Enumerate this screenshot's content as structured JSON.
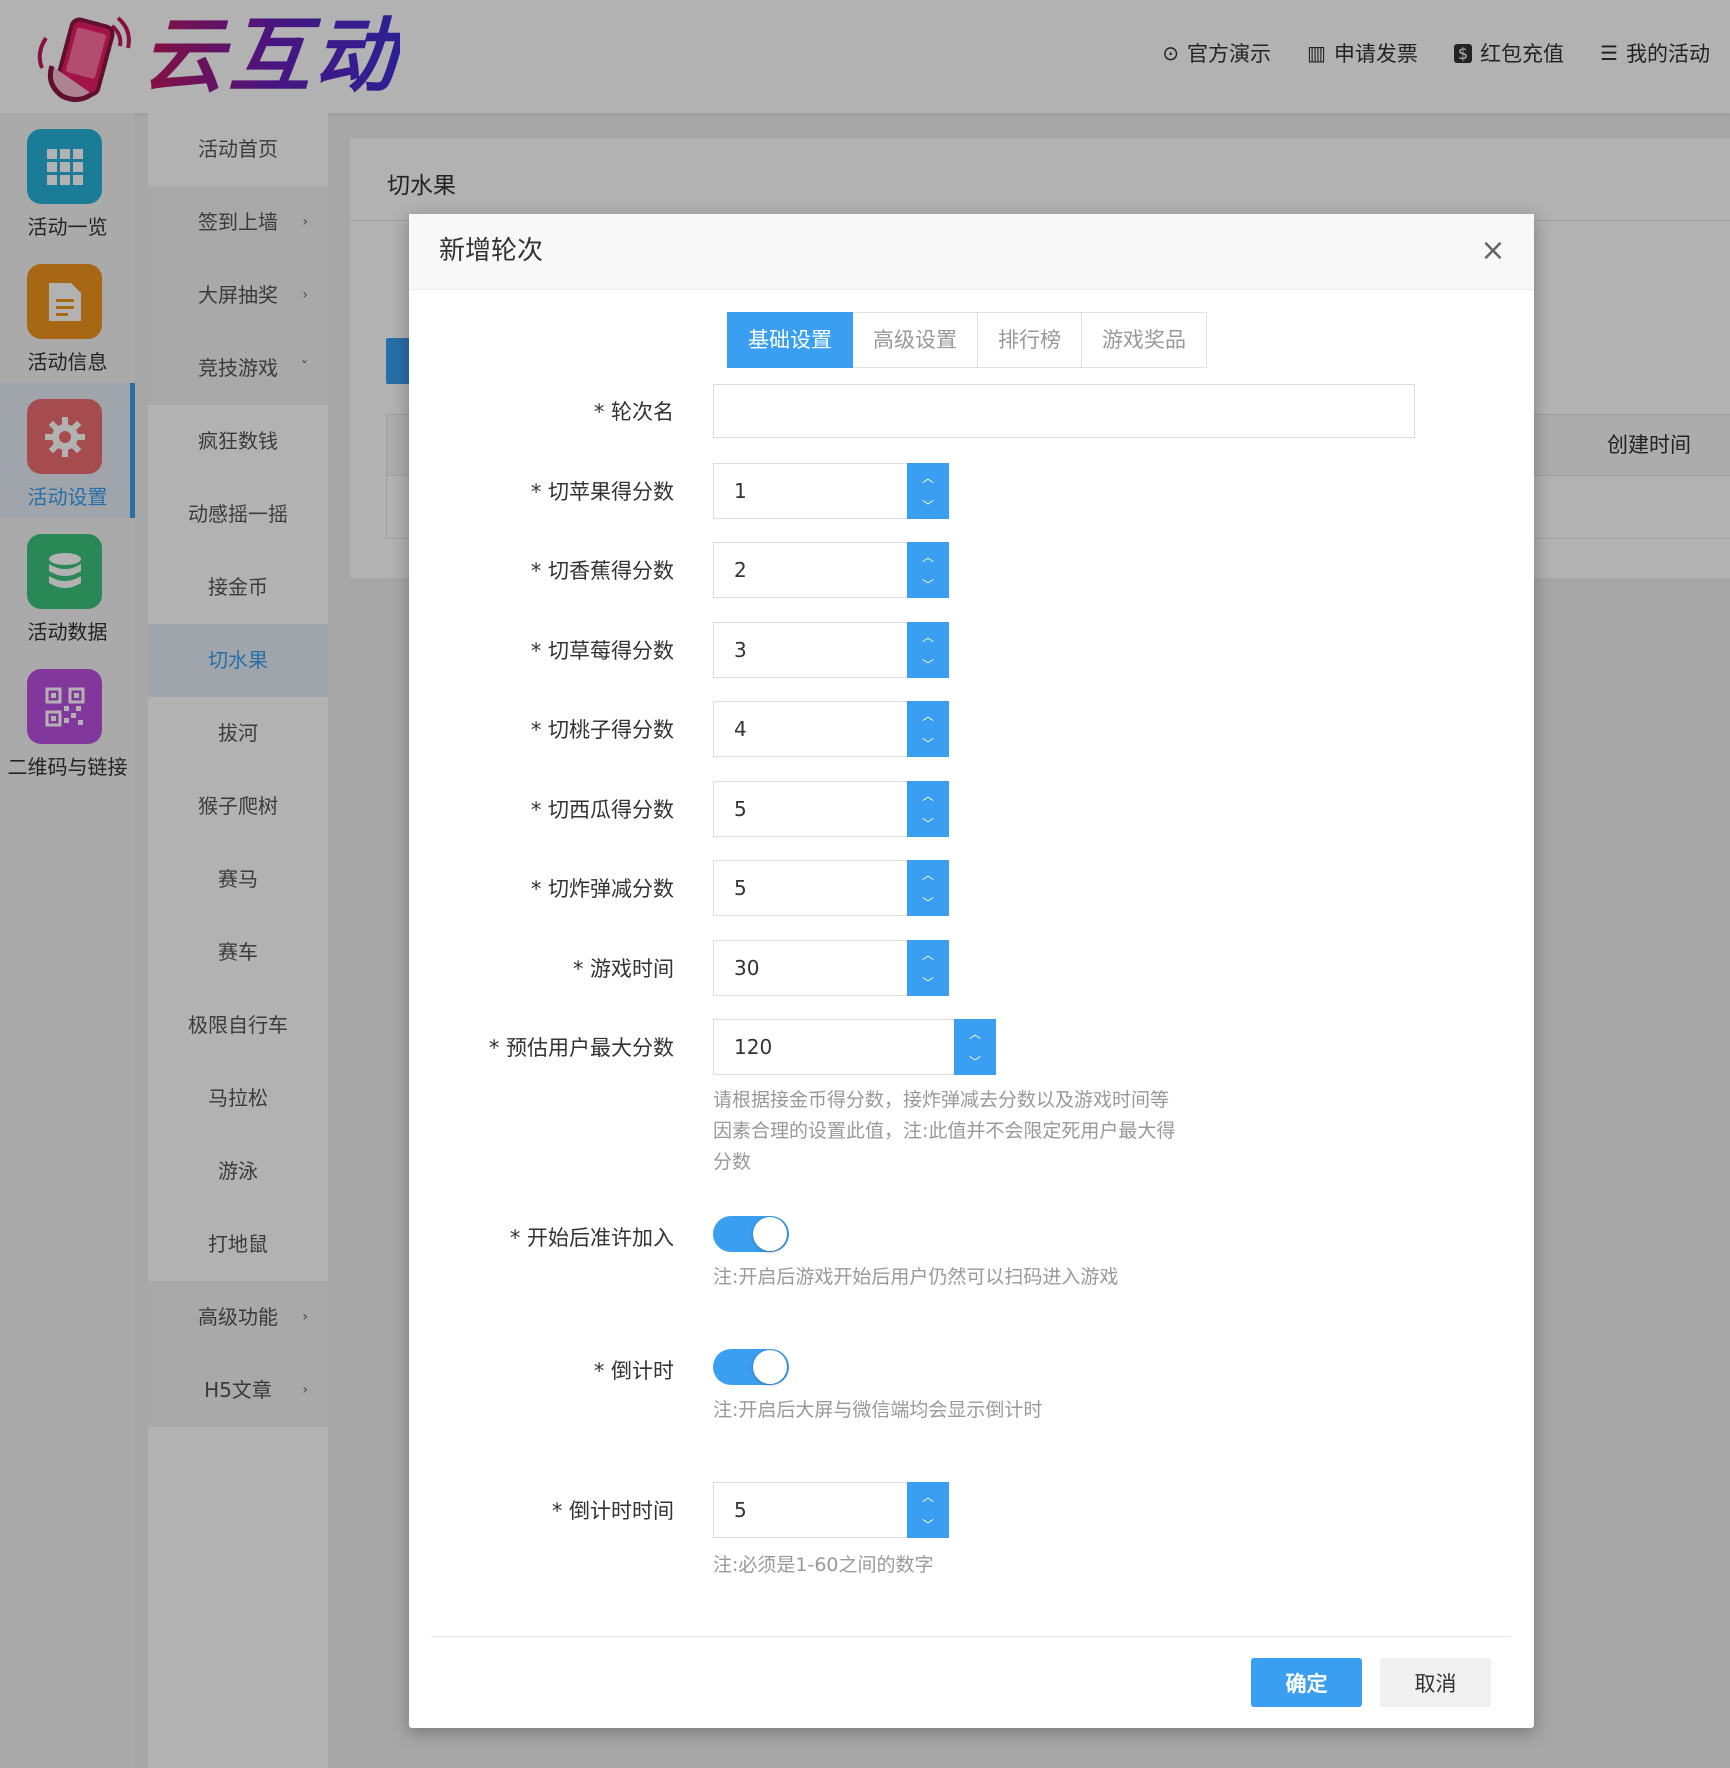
{
  "header": {
    "brand": "云互动",
    "links": [
      {
        "label": "官方演示",
        "icon": "play-circle-icon"
      },
      {
        "label": "申请发票",
        "icon": "barcode-icon"
      },
      {
        "label": "红包充值",
        "icon": "dollar-icon"
      },
      {
        "label": "我的活动",
        "icon": "list-icon"
      }
    ]
  },
  "iconbar": [
    {
      "label": "活动一览",
      "icon": "grid-icon",
      "color": "#26b2d8"
    },
    {
      "label": "活动信息",
      "icon": "document-icon",
      "color": "#f0941e"
    },
    {
      "label": "活动设置",
      "icon": "gear-icon",
      "color": "#ee6d72",
      "active": true
    },
    {
      "label": "活动数据",
      "icon": "database-icon",
      "color": "#3cc37a"
    },
    {
      "label": "二维码与链接",
      "icon": "qrcode-icon",
      "color": "#b94fe0"
    }
  ],
  "submenu": [
    {
      "label": "活动首页"
    },
    {
      "label": "签到上墙",
      "chevron": "›"
    },
    {
      "label": "大屏抽奖",
      "chevron": "›"
    },
    {
      "label": "竞技游戏",
      "chevron": "ˇ"
    },
    {
      "label": "疯狂数钱"
    },
    {
      "label": "动感摇一摇"
    },
    {
      "label": "接金币"
    },
    {
      "label": "切水果",
      "active": true
    },
    {
      "label": "拔河"
    },
    {
      "label": "猴子爬树"
    },
    {
      "label": "赛马"
    },
    {
      "label": "赛车"
    },
    {
      "label": "极限自行车"
    },
    {
      "label": "马拉松"
    },
    {
      "label": "游泳"
    },
    {
      "label": "打地鼠"
    },
    {
      "label": "高级功能",
      "chevron": "›"
    },
    {
      "label": "H5文章",
      "chevron": "›"
    }
  ],
  "content": {
    "title": "切水果",
    "table_header_create_time": "创建时间"
  },
  "modal": {
    "title": "新增轮次",
    "close": "×",
    "tabs": [
      "基础设置",
      "高级设置",
      "排行榜",
      "游戏奖品"
    ],
    "active_tab": 0,
    "fields": {
      "round_name": {
        "label": "* 轮次名",
        "value": ""
      },
      "apple": {
        "label": "* 切苹果得分数",
        "value": "1"
      },
      "banana": {
        "label": "* 切香蕉得分数",
        "value": "2"
      },
      "strawberry": {
        "label": "* 切草莓得分数",
        "value": "3"
      },
      "peach": {
        "label": "* 切桃子得分数",
        "value": "4"
      },
      "watermelon": {
        "label": "* 切西瓜得分数",
        "value": "5"
      },
      "bomb": {
        "label": "* 切炸弹减分数",
        "value": "5"
      },
      "game_time": {
        "label": "* 游戏时间",
        "value": "30"
      },
      "max_score": {
        "label": "* 预估用户最大分数",
        "value": "120",
        "hint_lines": [
          "请根据接金币得分数，接炸弹减去分数以及游戏时间等",
          "因素合理的设置此值，注:此值并不会限定死用户最大得",
          "分数"
        ]
      },
      "allow_join": {
        "label": "* 开始后准许加入",
        "on": true,
        "hint": "注:开启后游戏开始后用户仍然可以扫码进入游戏"
      },
      "countdown": {
        "label": "* 倒计时",
        "on": true,
        "hint": "注:开启后大屏与微信端均会显示倒计时"
      },
      "countdown_time": {
        "label": "* 倒计时时间",
        "value": "5",
        "hint": "注:必须是1-60之间的数字"
      }
    },
    "buttons": {
      "ok": "确定",
      "cancel": "取消"
    }
  }
}
